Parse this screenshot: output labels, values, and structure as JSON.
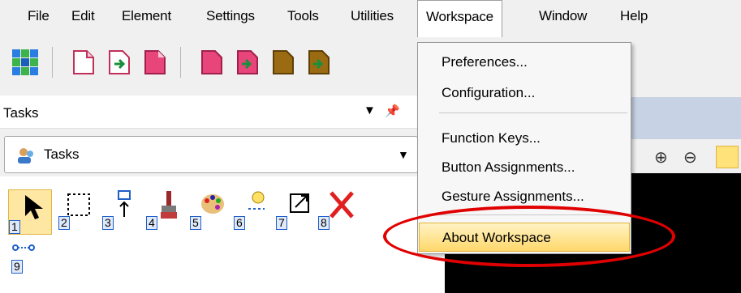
{
  "menubar": {
    "items": [
      {
        "label": "File"
      },
      {
        "label": "Edit"
      },
      {
        "label": "Element"
      },
      {
        "label": "Settings"
      },
      {
        "label": "Tools"
      },
      {
        "label": "Utilities"
      },
      {
        "label": "Workspace",
        "active": true
      },
      {
        "label": "Window"
      },
      {
        "label": "Help"
      }
    ]
  },
  "tasks_panel": {
    "title": "Tasks",
    "combo_value": "Tasks",
    "tools": [
      "1",
      "2",
      "3",
      "4",
      "5",
      "6",
      "7",
      "8",
      "9"
    ]
  },
  "workspace_menu": {
    "items": [
      {
        "label": "Preferences..."
      },
      {
        "label": "Configuration..."
      },
      {
        "label": "Function Keys..."
      },
      {
        "label": "Button Assignments..."
      },
      {
        "label": "Gesture Assignments..."
      },
      {
        "label": "About Workspace",
        "highlighted": true
      }
    ]
  },
  "annotation_color": "#e00000",
  "highlight_color": "#ffd86b"
}
